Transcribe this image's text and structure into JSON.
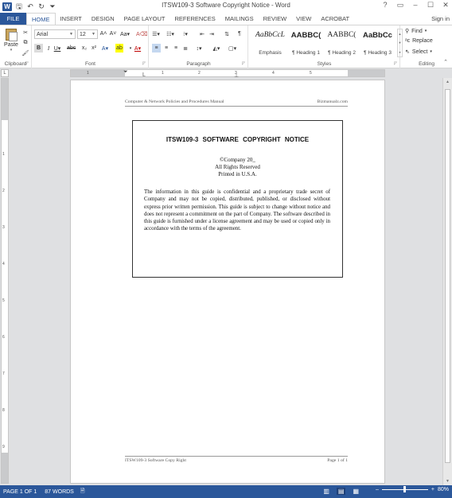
{
  "window": {
    "title": "ITSW109-3 Software Copyright Notice - Word",
    "controls": [
      "?",
      "▭",
      "–",
      "☐",
      "✕"
    ]
  },
  "qat": {
    "logo": "W",
    "icons": [
      "save-icon",
      "undo-icon",
      "redo-icon",
      "customize-icon"
    ]
  },
  "tabs": [
    {
      "label": "FILE"
    },
    {
      "label": "HOME"
    },
    {
      "label": "INSERT"
    },
    {
      "label": "DESIGN"
    },
    {
      "label": "PAGE LAYOUT"
    },
    {
      "label": "REFERENCES"
    },
    {
      "label": "MAILINGS"
    },
    {
      "label": "REVIEW"
    },
    {
      "label": "VIEW"
    },
    {
      "label": "ACROBAT"
    }
  ],
  "signin": "Sign in",
  "ribbon": {
    "clipboard": {
      "paste_label": "Paste",
      "group_label": "Clipboard"
    },
    "font": {
      "name": "Arial",
      "size": "12",
      "group_label": "Font"
    },
    "paragraph": {
      "group_label": "Paragraph"
    },
    "styles": {
      "group_label": "Styles",
      "items": [
        {
          "sample": "AaBbCcL",
          "name": "Emphasis"
        },
        {
          "sample": "AABBC(",
          "name": "¶ Heading 1"
        },
        {
          "sample": "AABBC(",
          "name": "¶ Heading 2"
        },
        {
          "sample": "AaBbCc",
          "name": "¶ Heading 3"
        }
      ]
    },
    "editing": {
      "group_label": "Editing",
      "find": "Find",
      "replace": "Replace",
      "select": "Select"
    }
  },
  "ruler": {
    "corner": "L",
    "numbers": [
      "1",
      "1",
      "2",
      "3",
      "4",
      "5"
    ],
    "v_numbers": [
      "1",
      "2",
      "3",
      "4",
      "5",
      "6",
      "7",
      "8",
      "9"
    ]
  },
  "document": {
    "header_left": "Computer & Network Policies and Procedures Manual",
    "header_right": "Bizmanualz.com",
    "title": "ITSW109-3   SOFTWARE COPYRIGHT NOTICE",
    "copyright": "©Company 20_",
    "rights": "All Rights Reserved",
    "printed": "Printed in U.S.A.",
    "paragraph": "The information in this guide is confidential and a proprietary trade secret of Company and may not be copied, distributed, published, or disclosed without express prior written permission.  This guide is subject to change without notice and does not represent a commitment on the part of Company.  The software described in this guide is furnished under a license agreement and may be used or copied only in accordance with the terms of the agreement.",
    "footer_left": "ITSW109-3 Software Copy Right",
    "footer_right": "Page 1 of 1"
  },
  "status": {
    "page": "PAGE 1 OF 1",
    "words": "87 WORDS",
    "zoom": "80%"
  },
  "colors": {
    "accent": "#2b579a",
    "canvas": "#dfe0e2"
  }
}
